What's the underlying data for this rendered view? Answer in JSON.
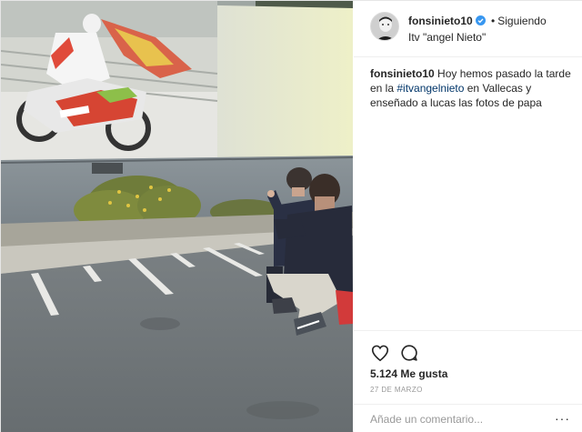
{
  "post": {
    "photo_alt_text": "",
    "icons": [
      "verified-badge-icon",
      "heart-icon",
      "comment-bubble-icon",
      "more-options-icon"
    ],
    "colors": {
      "hashtag": "#003569",
      "verified": "#3897f0",
      "muted": "#999999",
      "text": "#262626"
    }
  },
  "header": {
    "username": "fonsinieto10",
    "separator": "•",
    "follow_status": "Siguiendo",
    "location": "Itv \"angel Nieto\""
  },
  "caption": {
    "username": "fonsinieto10",
    "text_before": " Hoy hemos pasado la tarde en la ",
    "hashtag": "#itvangelnieto",
    "text_after": " en Vallecas y enseñado a lucas las fotos de papa"
  },
  "actions": {
    "likes": "5.124 Me gusta",
    "date": "27 DE MARZO"
  },
  "comment": {
    "placeholder": "Añade un comentario...",
    "more_label": "···"
  }
}
